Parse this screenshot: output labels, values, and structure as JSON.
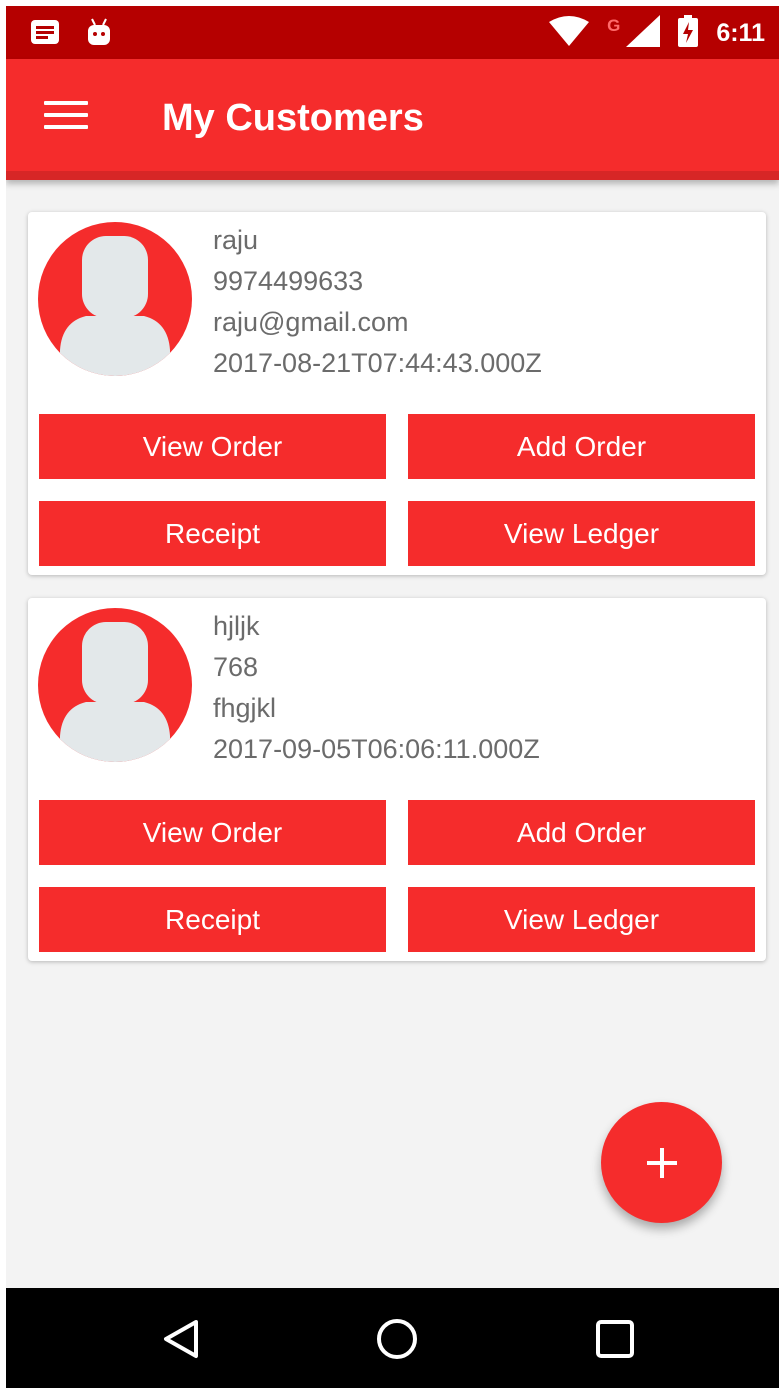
{
  "status_bar": {
    "time": "6:11",
    "network": "G",
    "icons": [
      "notification-icon",
      "android-icon",
      "wifi-icon",
      "signal-icon",
      "battery-charging-icon"
    ]
  },
  "app_bar": {
    "title": "My Customers",
    "menu_icon": "hamburger-menu-icon"
  },
  "customers": [
    {
      "name": "raju",
      "phone": "9974499633",
      "email": "raju@gmail.com",
      "created": "2017-08-21T07:44:43.000Z",
      "buttons": {
        "view_order": "View Order",
        "add_order": "Add Order",
        "receipt": "Receipt",
        "view_ledger": "View Ledger"
      }
    },
    {
      "name": "hjljk",
      "phone": "768",
      "email": "fhgjkl",
      "created": "2017-09-05T06:06:11.000Z",
      "buttons": {
        "view_order": "View Order",
        "add_order": "Add Order",
        "receipt": "Receipt",
        "view_ledger": "View Ledger"
      }
    }
  ],
  "fab": {
    "icon": "plus-icon"
  },
  "nav_bar": {
    "icons": [
      "back-icon",
      "home-icon",
      "recents-icon"
    ]
  },
  "colors": {
    "primary": "#f52c2c",
    "status_bar": "#b50000",
    "background": "#f3f3f3",
    "text_secondary": "#6b6b6b"
  }
}
